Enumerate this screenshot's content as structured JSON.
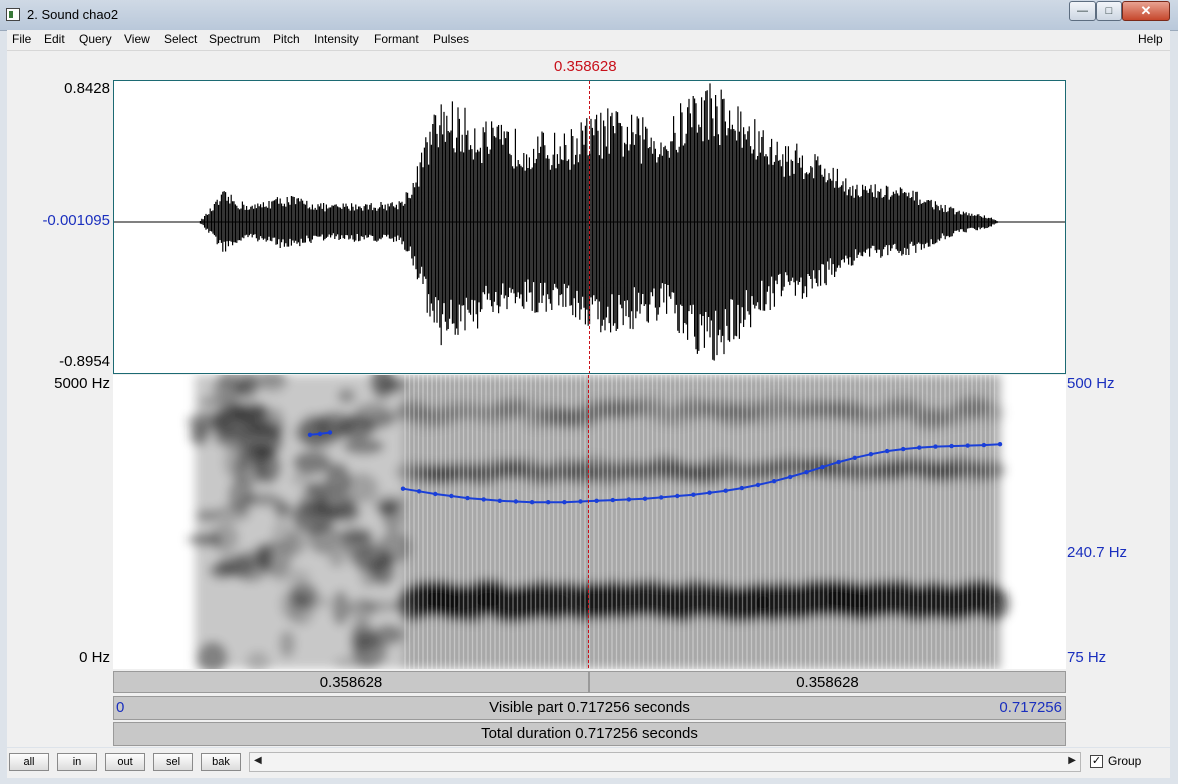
{
  "window": {
    "title": "2. Sound chao2"
  },
  "menu": [
    "File",
    "Edit",
    "Query",
    "View",
    "Select",
    "Spectrum",
    "Pitch",
    "Intensity",
    "Formant",
    "Pulses"
  ],
  "menu_help": "Help",
  "cursor": {
    "time_label": "0.358628",
    "time": 0.358628
  },
  "waveform": {
    "y_max": "0.8428",
    "y_center": "-0.001095",
    "y_min": "-0.8954"
  },
  "spectrogram": {
    "freq_top": "5000 Hz",
    "freq_bottom": "0 Hz",
    "pitch_top": "500 Hz",
    "pitch_cursor": "240.7 Hz",
    "pitch_bottom": "75 Hz",
    "pitch_track_hz": [
      240,
      236,
      232,
      229,
      226,
      224,
      222,
      221,
      220,
      220,
      220,
      221,
      222,
      223,
      224,
      225,
      227,
      229,
      231,
      234,
      237,
      241,
      246,
      252,
      259,
      267,
      276,
      285,
      293,
      300,
      306,
      310,
      313,
      315,
      316,
      317,
      318,
      320
    ],
    "pitch_blip_hz": [
      340,
      342,
      345
    ]
  },
  "time_bars": {
    "left": "0.358628",
    "right": "0.358628"
  },
  "visible": {
    "start": "0",
    "label": "Visible part 0.717256 seconds",
    "end": "0.717256"
  },
  "total": {
    "label": "Total duration 0.717256 seconds"
  },
  "buttons": {
    "all": "all",
    "in": "in",
    "out": "out",
    "sel": "sel",
    "bak": "bak"
  },
  "group": {
    "label": "Group",
    "checked": true
  },
  "colors": {
    "cursor": "#c8101a",
    "pitch": "#1a3fd8",
    "axis_blue": "#1a2fbe"
  }
}
